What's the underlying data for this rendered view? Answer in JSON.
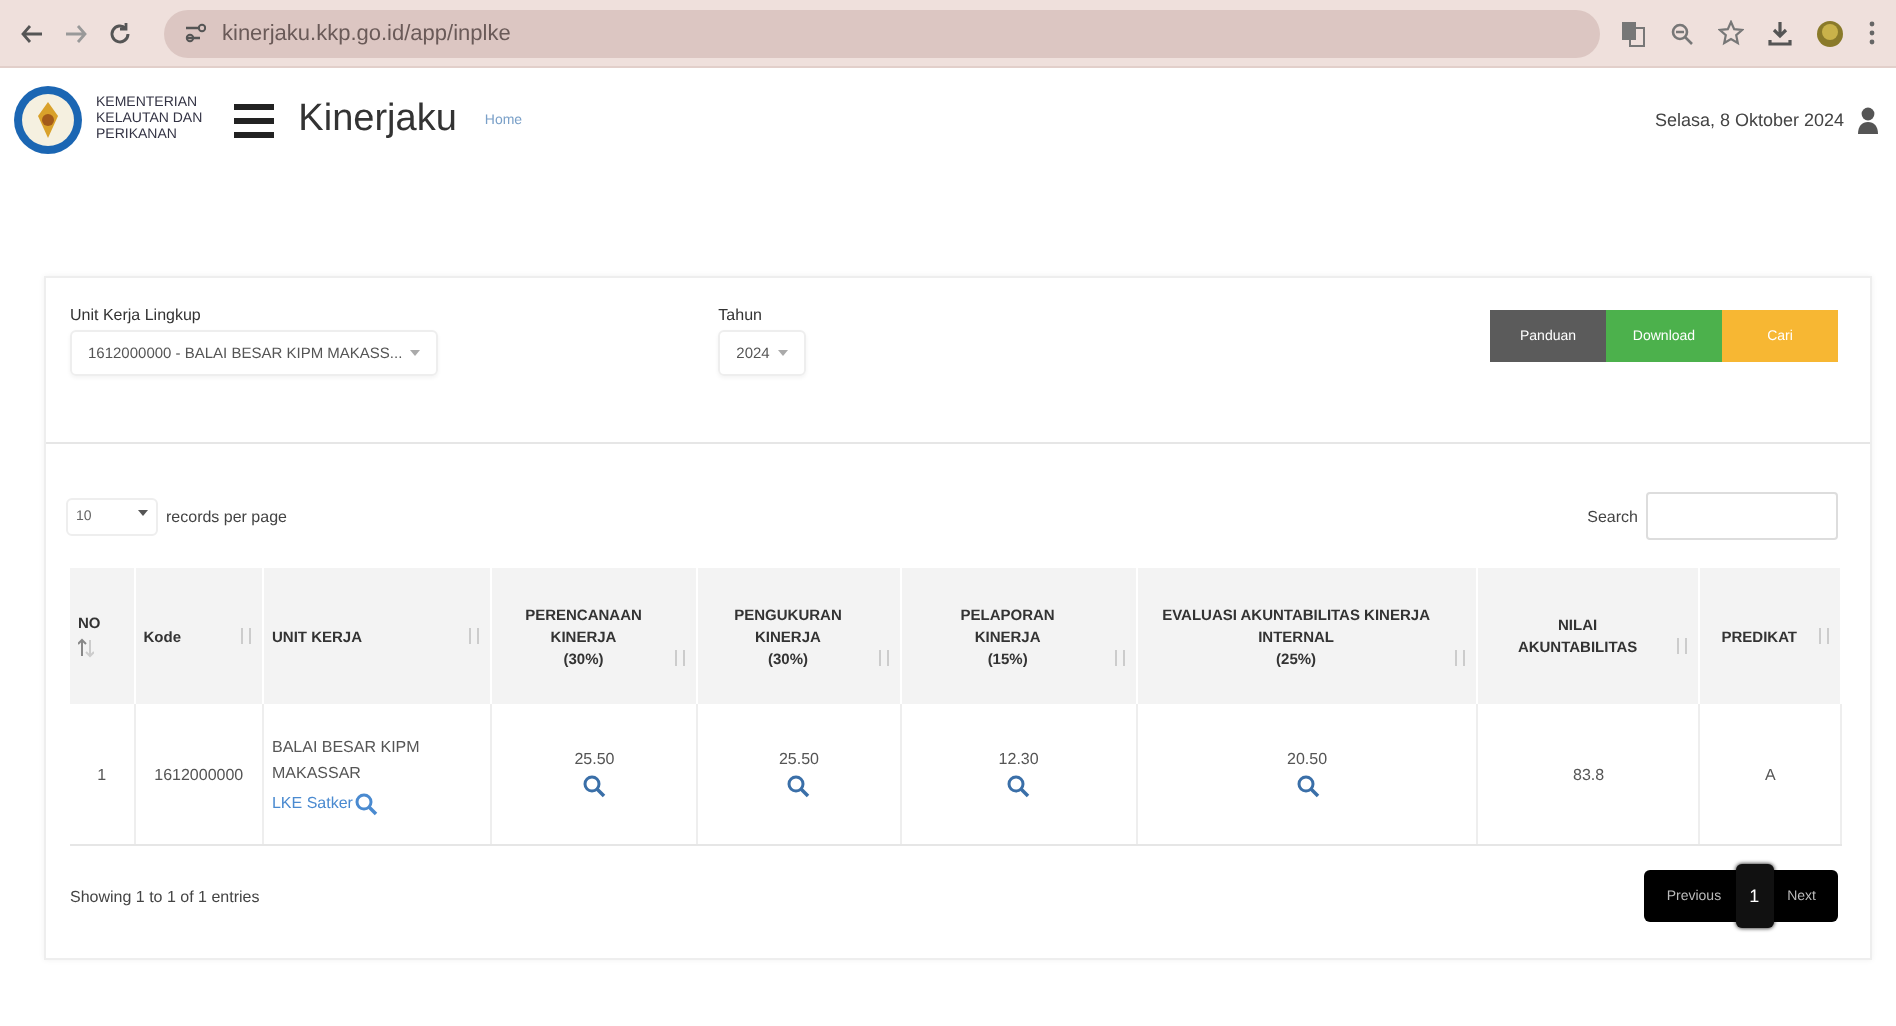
{
  "browser": {
    "url": "kinerjaku.kkp.go.id/app/inplke"
  },
  "header": {
    "org_name": [
      "KEMENTERIAN",
      "KELAUTAN DAN",
      "PERIKANAN"
    ],
    "app_title": "Kinerjaku",
    "breadcrumb": "Home",
    "date": "Selasa, 8 Oktober 2024"
  },
  "filters": [
    {
      "label": "Unit Kerja Lingkup",
      "value": "1612000000 - BALAI BESAR KIPM MAKASS..."
    },
    {
      "label": "Tahun",
      "value": "2024"
    }
  ],
  "actions": [
    {
      "label": "Panduan",
      "color": "#5b5b5b"
    },
    {
      "label": "Download",
      "color": "#4cb14c"
    },
    {
      "label": "Cari",
      "color": "#f7b733"
    }
  ],
  "table": {
    "page_size": "10",
    "page_size_label": "records per page",
    "search_label": "Search",
    "columns": [
      {
        "lines": [
          "NO"
        ],
        "sorted": true
      },
      {
        "lines": [
          "Kode"
        ],
        "sorted": false
      },
      {
        "lines": [
          "UNIT KERJA"
        ],
        "sorted": false
      },
      {
        "lines": [
          "PERENCANAAN",
          "KINERJA",
          "(30%)"
        ],
        "sorted": false
      },
      {
        "lines": [
          "PENGUKURAN",
          "KINERJA",
          "(30%)"
        ],
        "sorted": false
      },
      {
        "lines": [
          "PELAPORAN",
          "KINERJA",
          "(15%)"
        ],
        "sorted": false
      },
      {
        "lines": [
          "EVALUASI AKUNTABILITAS KINERJA",
          "INTERNAL",
          "(25%)"
        ],
        "sorted": false
      },
      {
        "lines": [
          "NILAI",
          "AKUNTABILITAS"
        ],
        "sorted": false
      },
      {
        "lines": [
          "PREDIKAT"
        ],
        "sorted": false
      }
    ],
    "rows": [
      {
        "no": "1",
        "kode": "1612000000",
        "unit_kerja": "BALAI BESAR KIPM MAKASSAR",
        "unit_link": "LKE Satker",
        "scores": [
          "25.50",
          "25.50",
          "12.30",
          "20.50"
        ],
        "nilai": "83.8",
        "predikat": "A"
      }
    ],
    "info": "Showing 1 to 1 of 1 entries",
    "pagination": [
      {
        "label": "Previous",
        "selected": false
      },
      {
        "label": "1",
        "selected": true
      },
      {
        "label": "Next",
        "selected": false
      }
    ]
  }
}
